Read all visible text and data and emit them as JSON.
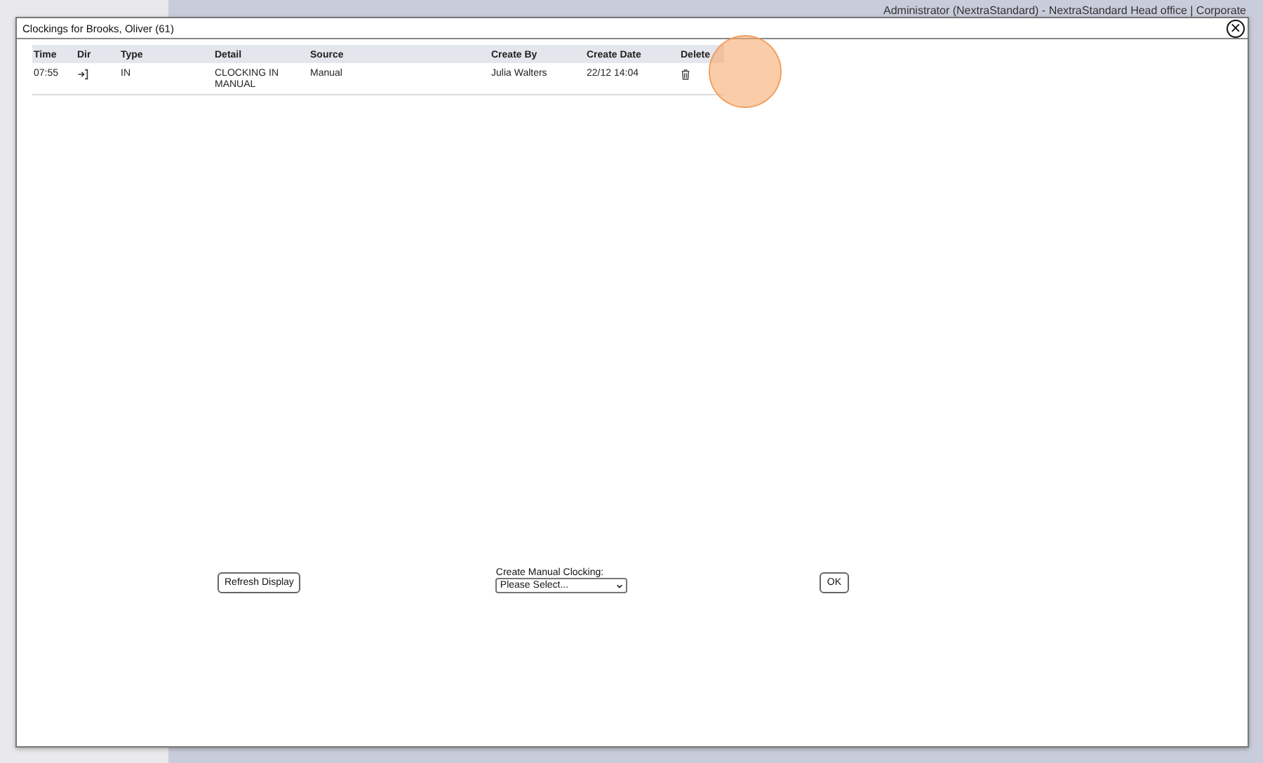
{
  "background": {
    "user_info": "Administrator (NextraStandard) - NextraStandard Head office | Corporate"
  },
  "dialog": {
    "title": "Clockings for Brooks, Oliver (61)",
    "close": "×",
    "table": {
      "columns": [
        "Time",
        "Dir",
        "Type",
        "Detail",
        "Source",
        "Create By",
        "Create Date",
        "Delete"
      ],
      "rows": [
        {
          "time": "07:55",
          "type": "IN",
          "detail": "CLOCKING IN MANUAL",
          "source": "Manual",
          "create_by": "Julia Walters",
          "create_date": "22/12 14:04"
        }
      ]
    },
    "refresh_button": "Refresh Display",
    "manual_clocking": {
      "label": "Create Manual Clocking:",
      "value": "Please Select..."
    },
    "ok_button": "OK"
  }
}
